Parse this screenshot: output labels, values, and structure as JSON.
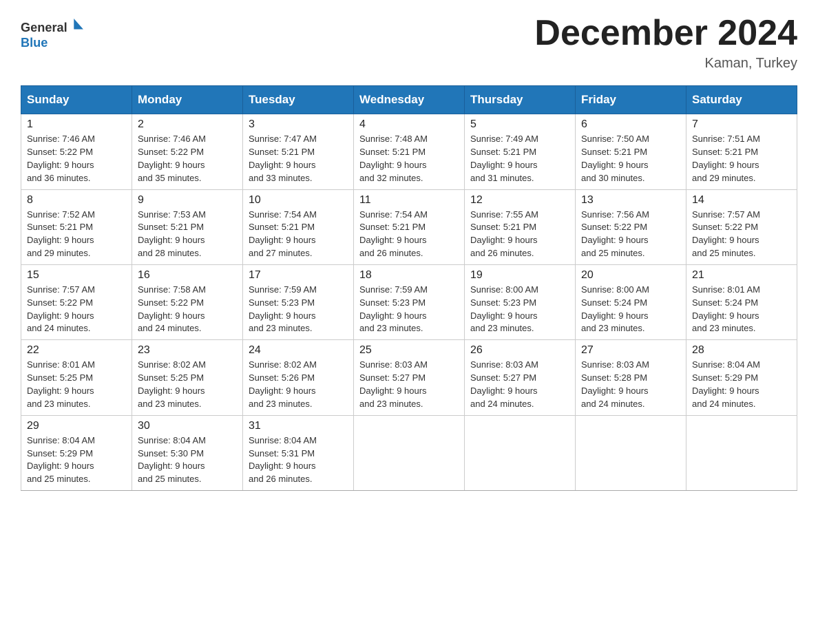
{
  "header": {
    "logo_line1": "General",
    "logo_line2": "Blue",
    "title": "December 2024",
    "location": "Kaman, Turkey"
  },
  "days_of_week": [
    "Sunday",
    "Monday",
    "Tuesday",
    "Wednesday",
    "Thursday",
    "Friday",
    "Saturday"
  ],
  "weeks": [
    [
      {
        "num": "1",
        "sunrise": "7:46 AM",
        "sunset": "5:22 PM",
        "daylight": "9 hours and 36 minutes."
      },
      {
        "num": "2",
        "sunrise": "7:46 AM",
        "sunset": "5:22 PM",
        "daylight": "9 hours and 35 minutes."
      },
      {
        "num": "3",
        "sunrise": "7:47 AM",
        "sunset": "5:21 PM",
        "daylight": "9 hours and 33 minutes."
      },
      {
        "num": "4",
        "sunrise": "7:48 AM",
        "sunset": "5:21 PM",
        "daylight": "9 hours and 32 minutes."
      },
      {
        "num": "5",
        "sunrise": "7:49 AM",
        "sunset": "5:21 PM",
        "daylight": "9 hours and 31 minutes."
      },
      {
        "num": "6",
        "sunrise": "7:50 AM",
        "sunset": "5:21 PM",
        "daylight": "9 hours and 30 minutes."
      },
      {
        "num": "7",
        "sunrise": "7:51 AM",
        "sunset": "5:21 PM",
        "daylight": "9 hours and 29 minutes."
      }
    ],
    [
      {
        "num": "8",
        "sunrise": "7:52 AM",
        "sunset": "5:21 PM",
        "daylight": "9 hours and 29 minutes."
      },
      {
        "num": "9",
        "sunrise": "7:53 AM",
        "sunset": "5:21 PM",
        "daylight": "9 hours and 28 minutes."
      },
      {
        "num": "10",
        "sunrise": "7:54 AM",
        "sunset": "5:21 PM",
        "daylight": "9 hours and 27 minutes."
      },
      {
        "num": "11",
        "sunrise": "7:54 AM",
        "sunset": "5:21 PM",
        "daylight": "9 hours and 26 minutes."
      },
      {
        "num": "12",
        "sunrise": "7:55 AM",
        "sunset": "5:21 PM",
        "daylight": "9 hours and 26 minutes."
      },
      {
        "num": "13",
        "sunrise": "7:56 AM",
        "sunset": "5:22 PM",
        "daylight": "9 hours and 25 minutes."
      },
      {
        "num": "14",
        "sunrise": "7:57 AM",
        "sunset": "5:22 PM",
        "daylight": "9 hours and 25 minutes."
      }
    ],
    [
      {
        "num": "15",
        "sunrise": "7:57 AM",
        "sunset": "5:22 PM",
        "daylight": "9 hours and 24 minutes."
      },
      {
        "num": "16",
        "sunrise": "7:58 AM",
        "sunset": "5:22 PM",
        "daylight": "9 hours and 24 minutes."
      },
      {
        "num": "17",
        "sunrise": "7:59 AM",
        "sunset": "5:23 PM",
        "daylight": "9 hours and 23 minutes."
      },
      {
        "num": "18",
        "sunrise": "7:59 AM",
        "sunset": "5:23 PM",
        "daylight": "9 hours and 23 minutes."
      },
      {
        "num": "19",
        "sunrise": "8:00 AM",
        "sunset": "5:23 PM",
        "daylight": "9 hours and 23 minutes."
      },
      {
        "num": "20",
        "sunrise": "8:00 AM",
        "sunset": "5:24 PM",
        "daylight": "9 hours and 23 minutes."
      },
      {
        "num": "21",
        "sunrise": "8:01 AM",
        "sunset": "5:24 PM",
        "daylight": "9 hours and 23 minutes."
      }
    ],
    [
      {
        "num": "22",
        "sunrise": "8:01 AM",
        "sunset": "5:25 PM",
        "daylight": "9 hours and 23 minutes."
      },
      {
        "num": "23",
        "sunrise": "8:02 AM",
        "sunset": "5:25 PM",
        "daylight": "9 hours and 23 minutes."
      },
      {
        "num": "24",
        "sunrise": "8:02 AM",
        "sunset": "5:26 PM",
        "daylight": "9 hours and 23 minutes."
      },
      {
        "num": "25",
        "sunrise": "8:03 AM",
        "sunset": "5:27 PM",
        "daylight": "9 hours and 23 minutes."
      },
      {
        "num": "26",
        "sunrise": "8:03 AM",
        "sunset": "5:27 PM",
        "daylight": "9 hours and 24 minutes."
      },
      {
        "num": "27",
        "sunrise": "8:03 AM",
        "sunset": "5:28 PM",
        "daylight": "9 hours and 24 minutes."
      },
      {
        "num": "28",
        "sunrise": "8:04 AM",
        "sunset": "5:29 PM",
        "daylight": "9 hours and 24 minutes."
      }
    ],
    [
      {
        "num": "29",
        "sunrise": "8:04 AM",
        "sunset": "5:29 PM",
        "daylight": "9 hours and 25 minutes."
      },
      {
        "num": "30",
        "sunrise": "8:04 AM",
        "sunset": "5:30 PM",
        "daylight": "9 hours and 25 minutes."
      },
      {
        "num": "31",
        "sunrise": "8:04 AM",
        "sunset": "5:31 PM",
        "daylight": "9 hours and 26 minutes."
      },
      null,
      null,
      null,
      null
    ]
  ],
  "labels": {
    "sunrise": "Sunrise:",
    "sunset": "Sunset:",
    "daylight": "Daylight:"
  }
}
